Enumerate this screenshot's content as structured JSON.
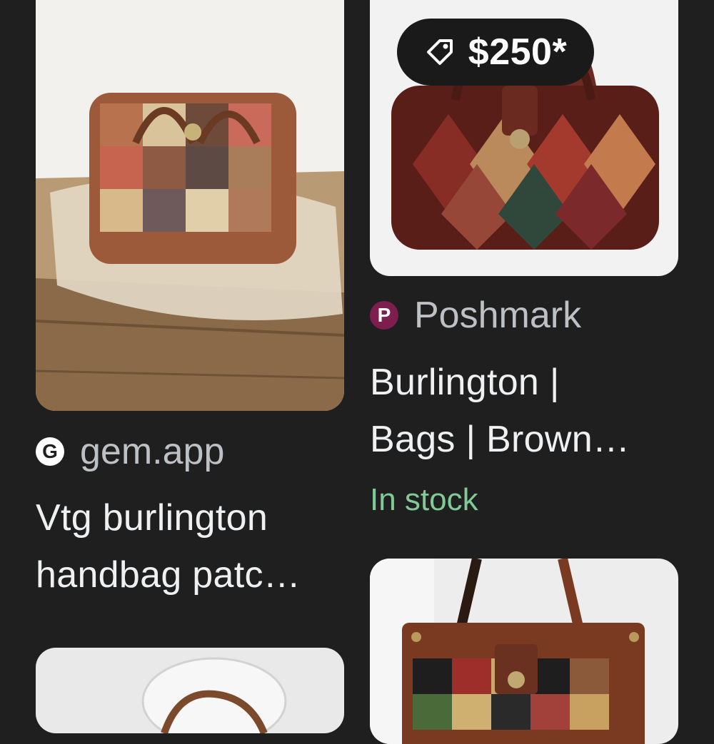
{
  "results": [
    {
      "source": "gem.app",
      "favicon_letter": "G",
      "title_line1": "Vtg burlington",
      "title_line2": "handbag patc…"
    },
    {
      "price": "$250*",
      "source": "Poshmark",
      "favicon_letter": "P",
      "title_line1": "Burlington |",
      "title_line2": "Bags | Brown…",
      "availability": "In stock"
    }
  ],
  "colors": {
    "background": "#1f1f1f",
    "in_stock": "#81c995",
    "poshmark_brand": "#7d1e4f"
  }
}
